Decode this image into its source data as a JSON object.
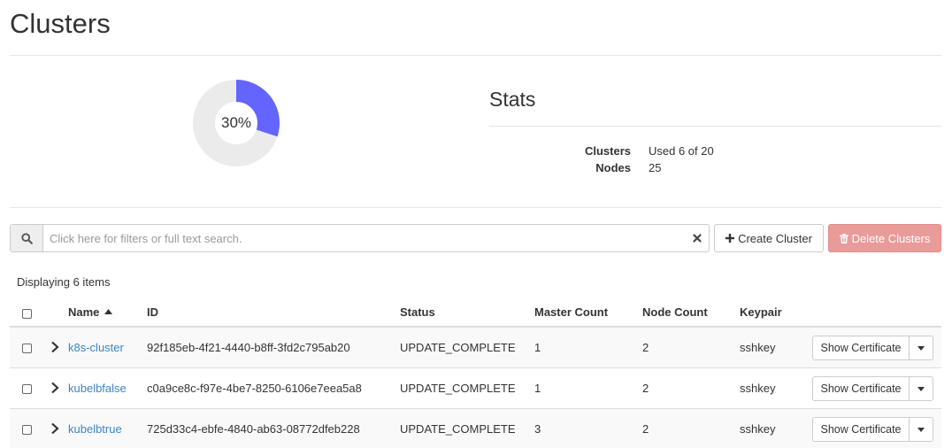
{
  "page": {
    "title": "Clusters"
  },
  "quota_chart": {
    "percent_label": "30%",
    "used_fraction": 0.3,
    "used_color": "#6464ff",
    "remaining_color": "#ebebeb"
  },
  "stats": {
    "title": "Stats",
    "rows": [
      {
        "key": "Clusters",
        "value": "Used 6 of 20"
      },
      {
        "key": "Nodes",
        "value": "25"
      }
    ]
  },
  "toolbar": {
    "search_placeholder": "Click here for filters or full text search.",
    "search_value": "",
    "create_label": "Create Cluster",
    "delete_label": "Delete Clusters"
  },
  "table": {
    "count_label": "Displaying 6 items",
    "columns": {
      "name": "Name",
      "id": "ID",
      "status": "Status",
      "master_count": "Master Count",
      "node_count": "Node Count",
      "keypair": "Keypair"
    },
    "rows": [
      {
        "name": "k8s-cluster",
        "id": "92f185eb-4f21-4440-b8ff-3fd2c795ab20",
        "status": "UPDATE_COMPLETE",
        "master_count": "1",
        "node_count": "2",
        "keypair": "sshkey",
        "action": "Show Certificate"
      },
      {
        "name": "kubelbfalse",
        "id": "c0a9ce8c-f97e-4be7-8250-6106e7eea5a8",
        "status": "UPDATE_COMPLETE",
        "master_count": "1",
        "node_count": "2",
        "keypair": "sshkey",
        "action": "Show Certificate"
      },
      {
        "name": "kubelbtrue",
        "id": "725d33c4-ebfe-4840-ab63-08772dfeb228",
        "status": "UPDATE_COMPLETE",
        "master_count": "3",
        "node_count": "2",
        "keypair": "sshkey",
        "action": "Show Certificate"
      }
    ]
  },
  "icons": {
    "search": "search-icon",
    "clear": "close-icon",
    "create": "plus-icon",
    "delete": "trash-icon",
    "sort": "sort-ascending-icon",
    "expand": "chevron-right-icon",
    "caret": "caret-down-icon"
  }
}
